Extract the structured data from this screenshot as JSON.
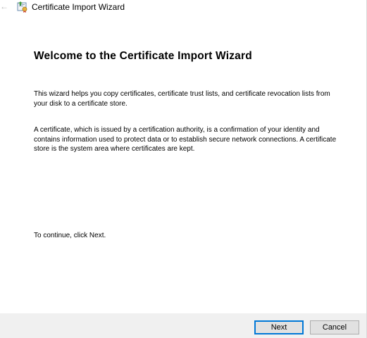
{
  "window": {
    "title": "Certificate Import Wizard",
    "back_icon": "back-arrow-icon",
    "app_icon": "certificate-icon"
  },
  "content": {
    "heading": "Welcome to the Certificate Import Wizard",
    "paragraph1": "This wizard helps you copy certificates, certificate trust lists, and certificate revocation lists from your disk to a certificate store.",
    "paragraph2": "A certificate, which is issued by a certification authority, is a confirmation of your identity and contains information used to protect data or to establish secure network connections. A certificate store is the system area where certificates are kept.",
    "paragraph3": "To continue, click Next."
  },
  "buttons": {
    "next": "Next",
    "cancel": "Cancel"
  },
  "colors": {
    "footer_bg": "#f0f0f0",
    "default_button_border": "#0078d7",
    "button_bg": "#e1e1e1"
  }
}
